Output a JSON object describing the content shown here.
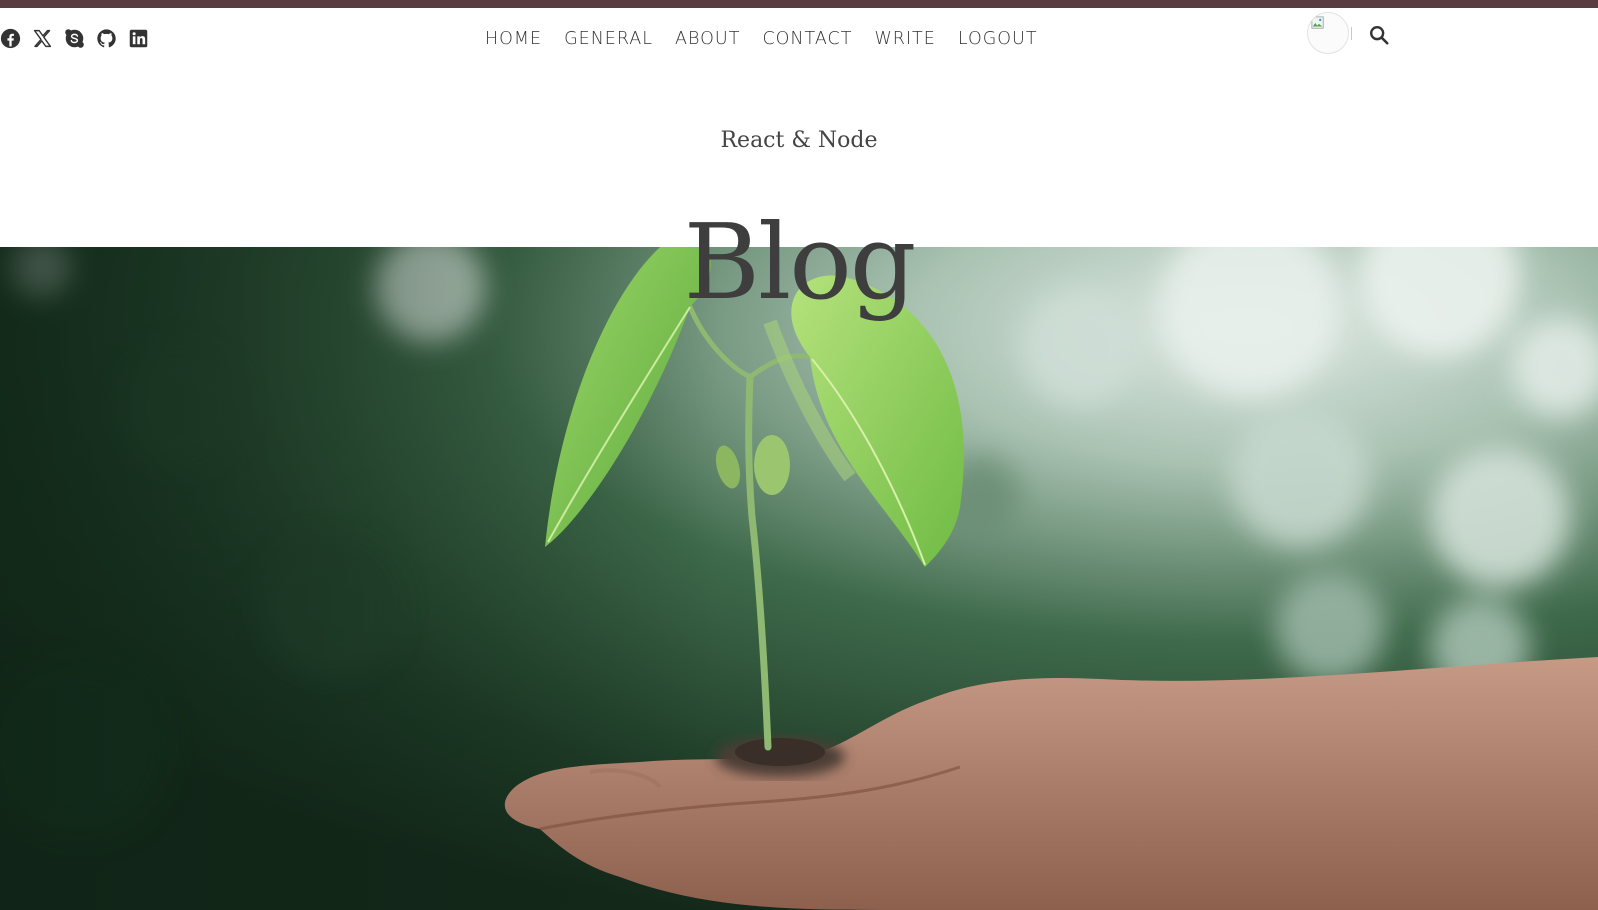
{
  "header": {
    "subtitle": "React & Node",
    "title": "Blog"
  },
  "social": [
    {
      "name": "facebook-icon"
    },
    {
      "name": "x-twitter-icon"
    },
    {
      "name": "skype-icon"
    },
    {
      "name": "github-icon"
    },
    {
      "name": "linkedin-icon"
    }
  ],
  "nav": {
    "items": [
      {
        "label": "HOME"
      },
      {
        "label": "GENERAL"
      },
      {
        "label": "ABOUT"
      },
      {
        "label": "CONTACT"
      },
      {
        "label": "WRITE"
      },
      {
        "label": "LOGOUT"
      }
    ]
  },
  "colors": {
    "top_strip": "#5a3b3f",
    "text": "#333333",
    "title": "#3e3e3e"
  },
  "icons": {
    "avatar": "broken-image-icon",
    "search": "search-icon"
  }
}
